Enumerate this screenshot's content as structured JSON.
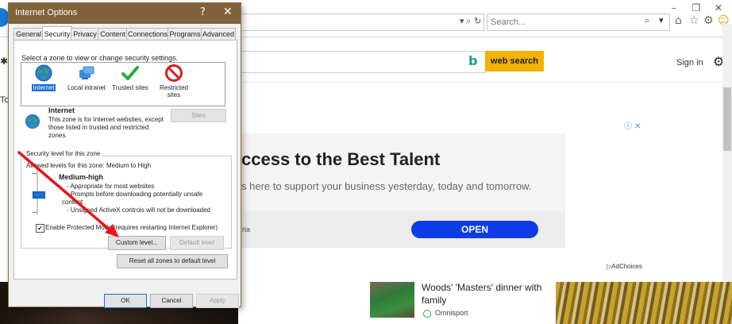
{
  "browser": {
    "window_controls": [
      "–",
      "❒",
      "✕"
    ],
    "address_bar": {
      "search_glyph": "⌕",
      "dropdown": "▾",
      "refresh": "↻"
    },
    "search_box": {
      "placeholder": "Search...",
      "icon": "⌕",
      "dropdown": "▾"
    },
    "toolbar_icons": {
      "home": "⌂",
      "favorites": "☆",
      "settings": "⚙",
      "feedback": "☺"
    }
  },
  "page": {
    "search_button": "web search",
    "bing_logo": "b",
    "sign_in": "Sign in",
    "settings_icon": "⚙",
    "left_peek": {
      "item1": "✱",
      "item2": "To"
    },
    "ad": {
      "headline": "ccess to the Best Talent",
      "subtext": "s here to support your business yesterday, today and tomorrow.",
      "advertiser_fragment": "ria",
      "open_button": "OPEN",
      "adchoices_top": "ⓘ ✕",
      "adchoices_bottom": "▷AdChoices"
    },
    "news": {
      "title": "Woods' 'Masters' dinner with family",
      "source": "Omnisport"
    }
  },
  "dialog": {
    "title": "Internet Options",
    "help": "?",
    "close": "✕",
    "tabs": [
      "General",
      "Security",
      "Privacy",
      "Content",
      "Connections",
      "Programs",
      "Advanced"
    ],
    "active_tab": "Security",
    "zone_prompt": "Select a zone to view or change security settings.",
    "zones": [
      {
        "label": "Internet",
        "icon": "globe-icon",
        "selected": true
      },
      {
        "label": "Local intranet",
        "icon": "network-icon",
        "selected": false
      },
      {
        "label": "Trusted sites",
        "icon": "checkmark-icon",
        "selected": false
      },
      {
        "label": "Restricted sites",
        "icon": "no-entry-icon",
        "selected": false
      }
    ],
    "zone_info": {
      "name": "Internet",
      "description": "This zone is for Internet websites, except those listed in trusted and restricted zones.",
      "sites_button": "Sites"
    },
    "security_level": {
      "legend": "Security level for this zone",
      "allowed": "Allowed levels for this zone: Medium to High",
      "level_name": "Medium-high",
      "bullets": [
        "- Appropriate for most websites",
        "- Prompts before downloading potentially unsafe",
        "content",
        "- Unsigned ActiveX controls will not be downloaded"
      ]
    },
    "protected_mode": {
      "checked": true,
      "check_glyph": "✔",
      "label": "Enable Protected Mode (requires restarting Internet Explorer)"
    },
    "buttons": {
      "custom_level": "Custom level...",
      "default_level": "Default level",
      "reset_all": "Reset all zones to default level",
      "ok": "OK",
      "cancel": "Cancel",
      "apply": "Apply"
    }
  },
  "colors": {
    "titlebar": "#80623a",
    "accent_blue": "#1a6fd1",
    "search_button": "#f2b200",
    "open_button": "#0b3ce6",
    "annotation_arrow": "#e4161c"
  }
}
